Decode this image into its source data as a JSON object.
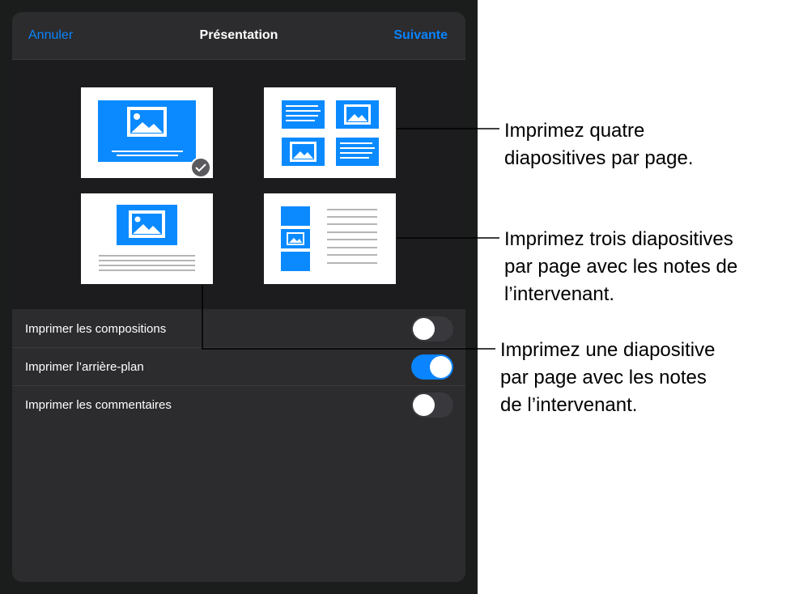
{
  "header": {
    "cancel_label": "Annuler",
    "title": "Présentation",
    "next_label": "Suivante"
  },
  "layouts": [
    {
      "name": "one-slide",
      "selected": true
    },
    {
      "name": "four-slides",
      "selected": false
    },
    {
      "name": "one-slide-with-notes",
      "selected": false
    },
    {
      "name": "three-slides-with-notes",
      "selected": false
    }
  ],
  "options": [
    {
      "label": "Imprimer les compositions",
      "on": false
    },
    {
      "label": "Imprimer l’arrière-plan",
      "on": true
    },
    {
      "label": "Imprimer les commentaires",
      "on": false
    }
  ],
  "callouts": [
    {
      "lines": [
        "Imprimez quatre",
        "diapositives par page."
      ]
    },
    {
      "lines": [
        "Imprimez trois diapositives",
        "par page avec les notes de",
        "l’intervenant."
      ]
    },
    {
      "lines": [
        "Imprimez une diapositive",
        "par page avec les notes",
        "de l’intervenant."
      ]
    }
  ],
  "colors": {
    "accent": "#0a84ff",
    "slide_blue": "#0b8aff",
    "panel": "#2c2c2e",
    "toggle_off": "#39393d"
  }
}
